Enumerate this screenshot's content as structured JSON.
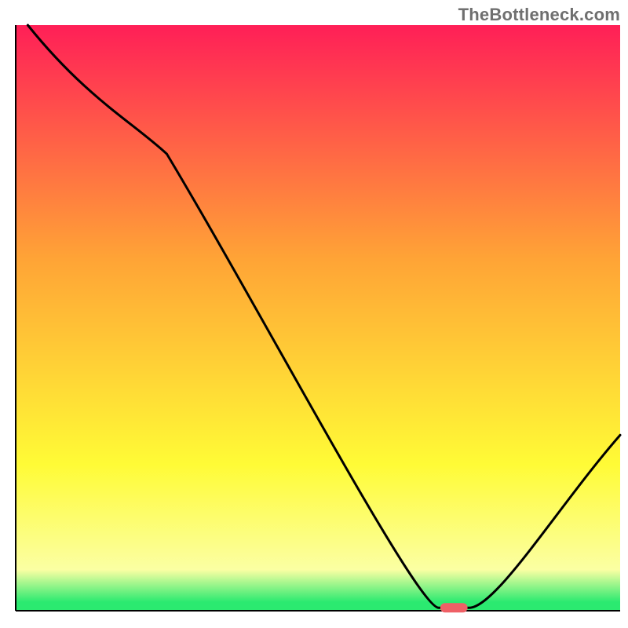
{
  "watermark": "TheBottleneck.com",
  "colors": {
    "white": "#ffffff",
    "black": "#000000",
    "pink": "#ff1f57",
    "orange": "#ffa436",
    "yellow": "#fffb36",
    "paleyellow": "#fbffa3",
    "green": "#2bea70",
    "marker": "#ef6066"
  },
  "chart_data": {
    "type": "line",
    "title": "",
    "xlabel": "",
    "ylabel": "",
    "xlim": [
      0,
      100
    ],
    "ylim": [
      0,
      100
    ],
    "x": [
      2,
      25,
      70,
      75,
      100
    ],
    "values": [
      100,
      78,
      0.5,
      0.5,
      30
    ],
    "marker": {
      "x_center": 72.5,
      "y": 0.5,
      "width_pct": 4.5
    },
    "background_gradient_stops": [
      {
        "offset": 0.0,
        "color": "pink"
      },
      {
        "offset": 0.4,
        "color": "orange"
      },
      {
        "offset": 0.75,
        "color": "yellow"
      },
      {
        "offset": 0.93,
        "color": "paleyellow"
      },
      {
        "offset": 0.985,
        "color": "green"
      },
      {
        "offset": 1.0,
        "color": "green"
      }
    ]
  }
}
